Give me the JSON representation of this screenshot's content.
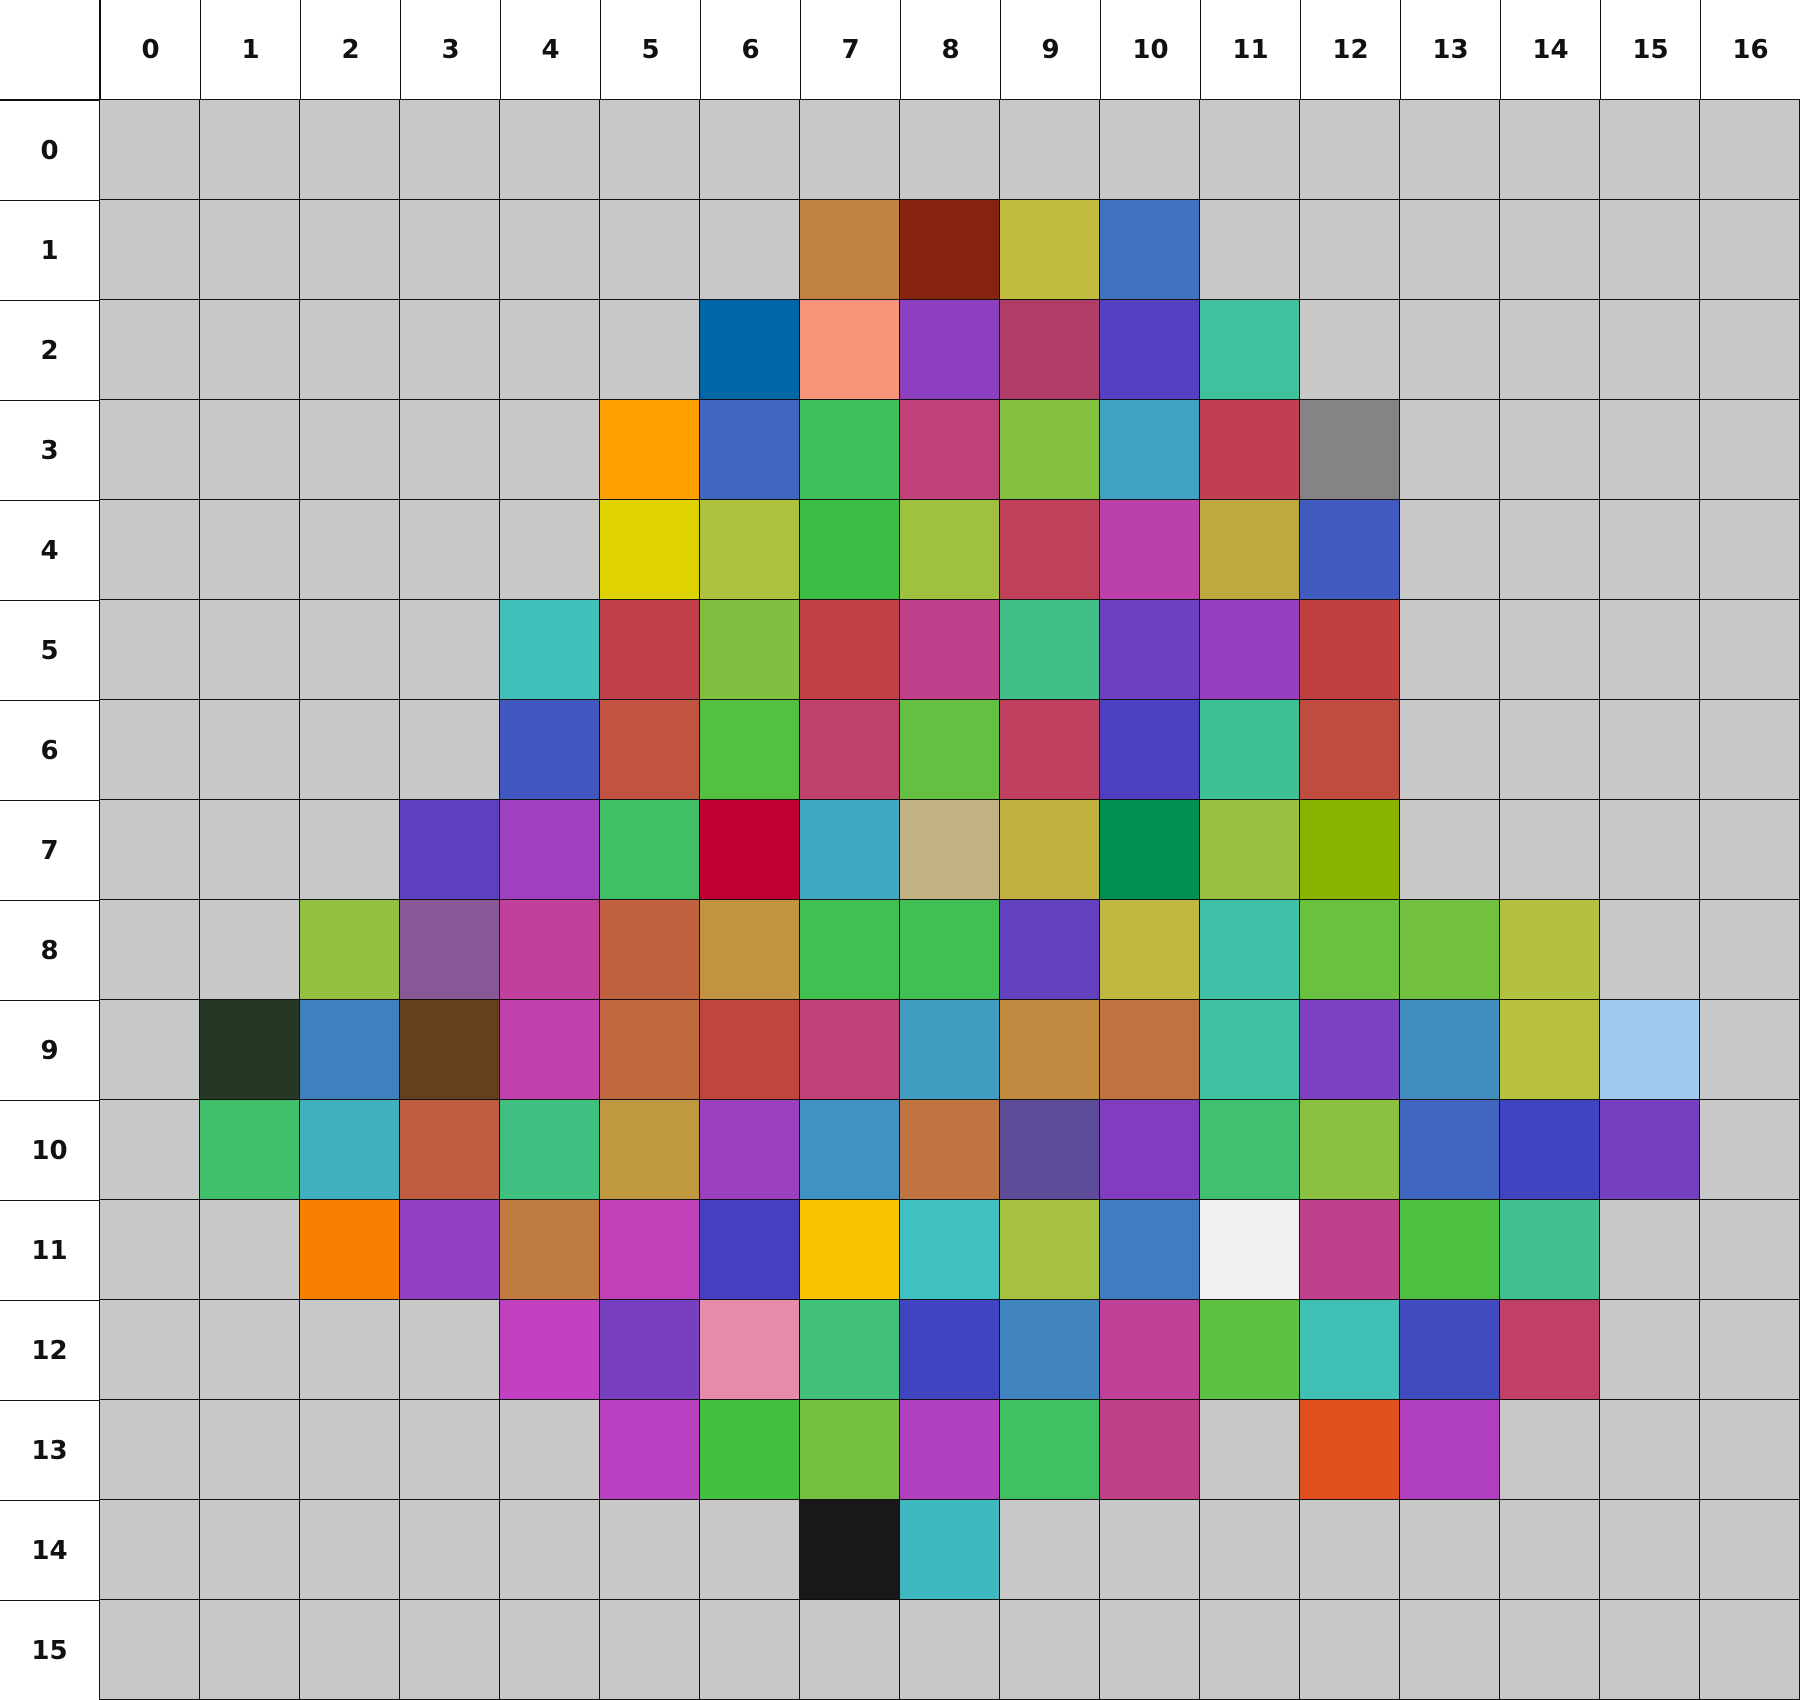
{
  "grid": {
    "columns": [
      "0",
      "1",
      "2",
      "3",
      "4",
      "5",
      "6",
      "7",
      "8",
      "9",
      "10",
      "11",
      "12",
      "13",
      "14",
      "15",
      "16"
    ],
    "rows": [
      "0",
      "1",
      "2",
      "3",
      "4",
      "5",
      "6",
      "7",
      "8",
      "9",
      "10",
      "11",
      "12",
      "13",
      "14",
      "15"
    ],
    "empty_color": "#c8c8c8",
    "cells": [
      [
        null,
        null,
        null,
        null,
        null,
        null,
        null,
        null,
        null,
        null,
        null,
        null,
        null,
        null,
        null,
        null,
        null
      ],
      [
        null,
        null,
        null,
        null,
        null,
        null,
        null,
        "#c08240",
        "#862410",
        "#c0bc40",
        "#4072c0",
        null,
        null,
        null,
        null,
        null,
        null
      ],
      [
        null,
        null,
        null,
        null,
        null,
        null,
        "#0066a8",
        "#f89478",
        "#8c40c0",
        "#b03c68",
        "#5440c0",
        "#40c09c",
        null,
        null,
        null,
        null,
        null
      ],
      [
        null,
        null,
        null,
        null,
        null,
        "#ffa000",
        "#4066c0",
        "#40c05a",
        "#c0407a",
        "#84c040",
        "#40a2c0",
        "#c04052",
        "#848484",
        null,
        null,
        null,
        null
      ],
      [
        null,
        null,
        null,
        null,
        null,
        "#ded200",
        "#aec040",
        "#3cbe44",
        "#a0c040",
        "#c0405a",
        "#bc40aa",
        "#c0a840",
        "#405ac0",
        null,
        null,
        null,
        null
      ],
      [
        null,
        null,
        null,
        null,
        "#40c0b8",
        "#c0404c",
        "#80c040",
        "#c04048",
        "#c0408c",
        "#40c088",
        "#6c40c0",
        "#9640c0",
        "#c04040",
        null,
        null,
        null,
        null
      ],
      [
        null,
        null,
        null,
        null,
        "#4058c0",
        "#c05440",
        "#54c040",
        "#c0406c",
        "#64c040",
        "#c04060",
        "#4c40c0",
        "#40c096",
        "#c04c40",
        null,
        null,
        null,
        null
      ],
      [
        null,
        null,
        null,
        "#5c40c0",
        "#a040c0",
        "#40c066",
        "#c00030",
        "#40a8c0",
        "#c2b282",
        "#c0b040",
        "#009050",
        "#9ac040",
        "#88b400",
        null,
        null,
        null,
        null
      ],
      [
        null,
        null,
        "#94c040",
        "#885896",
        "#c0409c",
        "#c06240",
        "#c09440",
        "#40c050",
        "#40c052",
        "#6240c0",
        "#c0b840",
        "#40c0a6",
        "#6cc040",
        "#72c040",
        "#b4c040",
        null,
        null
      ],
      [
        null,
        "#243824",
        "#4080c0",
        "#64401c",
        "#c040ae",
        "#c06840",
        "#c04440",
        "#c04078",
        "#409cc0",
        "#c08a40",
        "#c07240",
        "#40c0a2",
        "#7c40c0",
        "#408ec0",
        "#b8c040",
        "#a0caf0",
        null
      ],
      [
        null,
        "#40c06a",
        "#40b0c0",
        "#c05c40",
        "#40c080",
        "#c09840",
        "#9c40c0",
        "#4092c0",
        "#c07440",
        "#5e4c98",
        "#823cc0",
        "#40c070",
        "#8cc040",
        "#4066c0",
        "#4044c0",
        "#7440c0",
        null
      ],
      [
        null,
        null,
        "#f88000",
        "#9040c0",
        "#c07c40",
        "#c040b8",
        "#4440c0",
        "#f8c400",
        "#40c0c0",
        "#a6c040",
        "#407cc0",
        "#f0f0f0",
        "#c0408c",
        "#4cc040",
        "#40c090",
        null,
        null
      ],
      [
        null,
        null,
        null,
        null,
        "#c040c0",
        "#7840c0",
        "#e68ca8",
        "#40c078",
        "#4044c0",
        "#4084c0",
        "#c04098",
        "#5cc040",
        "#40c0b4",
        "#404cc0",
        "#c04068",
        null,
        null
      ],
      [
        null,
        null,
        null,
        null,
        null,
        "#b840c0",
        "#44c040",
        "#74c040",
        "#b040c0",
        "#40c062",
        "#c04088",
        null,
        "#e0501c",
        "#b040c0",
        null,
        null,
        null
      ],
      [
        null,
        null,
        null,
        null,
        null,
        null,
        null,
        "#181818",
        "#40b8c0",
        null,
        null,
        null,
        null,
        null,
        null,
        null,
        null
      ],
      [
        null,
        null,
        null,
        null,
        null,
        null,
        null,
        null,
        null,
        null,
        null,
        null,
        null,
        null,
        null,
        null,
        null
      ]
    ]
  }
}
